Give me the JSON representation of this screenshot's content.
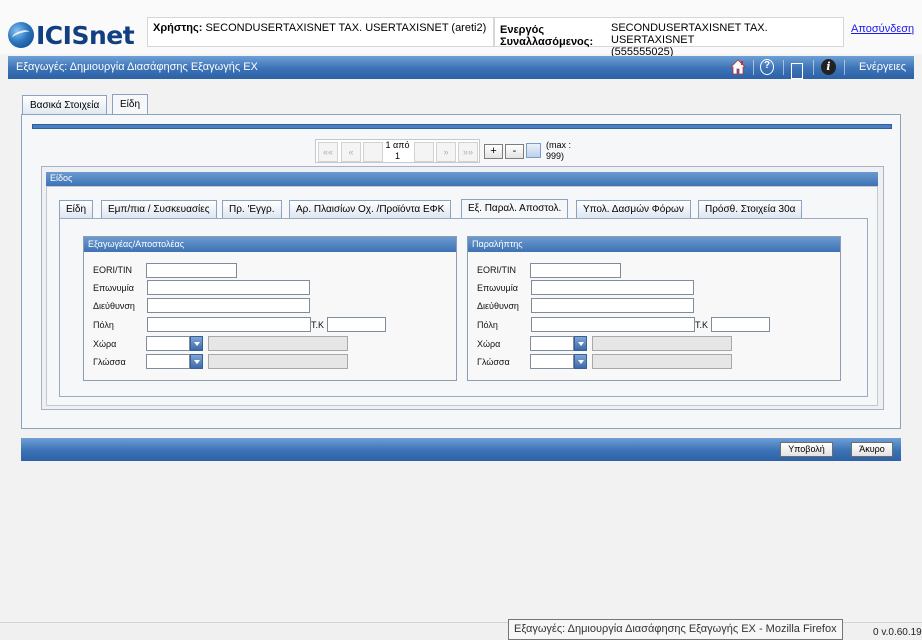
{
  "header": {
    "logo_text": "ICISnet",
    "user_label": "Χρήστης:",
    "user_value": "SECONDUSERTAXISNET TAX. USERTAXISNET (areti2)",
    "actor_label_line1": "Ενεργός",
    "actor_label_line2": "Συναλλασόμενος:",
    "actor_value_line1": "SECONDUSERTAXISNET TAX. USERTAXISNET",
    "actor_value_line2": "(555555025)",
    "logout": "Αποσύνδεση"
  },
  "titlebar": {
    "title": "Εξαγωγές: Δημιουργία Διασάφησης Εξαγωγής EX",
    "icons": [
      "home-icon",
      "help-icon",
      "window-icon",
      "info-icon"
    ],
    "actions": "Ενέργειες"
  },
  "main_tabs": [
    {
      "label": "Βασικά Στοιχεία",
      "active": false
    },
    {
      "label": "Είδη",
      "active": true
    }
  ],
  "pager": {
    "first": "««",
    "prev": "«",
    "page_line1": "1 από",
    "page_line2": "1",
    "next": "»",
    "last": "»»",
    "add": "+",
    "remove": "-",
    "max_line1": "(max :",
    "max_line2": "999)"
  },
  "item": {
    "header": "Είδος",
    "tabs": [
      {
        "label": "Είδη",
        "active": false
      },
      {
        "label": "Εμπ/πια / Συσκευασίες",
        "active": false
      },
      {
        "label": "Πρ. 'Εγγρ.",
        "active": false
      },
      {
        "label": "Αρ. Πλαισίων Οχ. /Προϊόντα ΕΦΚ",
        "active": false
      },
      {
        "label": "Εξ. Παραλ. Αποστολ.",
        "active": true
      },
      {
        "label": "Υπολ. Δασμών Φόρων",
        "active": false
      },
      {
        "label": "Πρόσθ. Στοιχεία 30α",
        "active": false
      }
    ]
  },
  "exporter": {
    "header": "Εξαγωγέας/Αποστολέας",
    "eori_label": "EORI/TIN",
    "name_label": "Επωνυμία",
    "address_label": "Διεύθυνση",
    "city_label": "Πόλη",
    "zip_label": "Τ.Κ",
    "country_label": "Χώρα",
    "language_label": "Γλώσσα"
  },
  "consignee": {
    "header": "Παραλήπτης",
    "eori_label": "EORI/TIN",
    "name_label": "Επωνυμία",
    "address_label": "Διεύθυνση",
    "city_label": "Πόλη",
    "zip_label": "Τ.Κ",
    "country_label": "Χώρα",
    "language_label": "Γλώσσα"
  },
  "footer": {
    "submit": "Υποβολή",
    "cancel": "Άκυρο"
  },
  "status": {
    "tooltip": "Εξαγωγές: Δημιουργία Διασάφησης Εξαγωγής EX - Mozilla Firefox",
    "version": "0 v.0.60.19"
  }
}
